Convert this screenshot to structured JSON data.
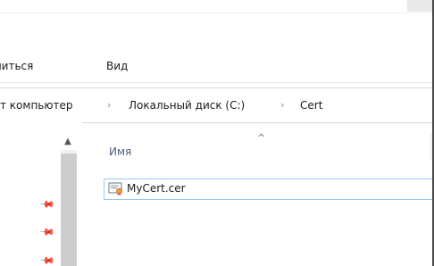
{
  "ribbon": {
    "tabs": [
      {
        "label": "литься"
      },
      {
        "label": "Вид"
      }
    ]
  },
  "address": {
    "crumbs": [
      {
        "label": "т компьютер"
      },
      {
        "label": "Локальный диск (C:)"
      },
      {
        "label": "Cert"
      }
    ],
    "separator": "›"
  },
  "nav": {
    "scroll_up_glyph": "▲",
    "pin_glyph": "📌"
  },
  "content": {
    "columns": [
      {
        "label": "Имя",
        "sorted": "ascending"
      }
    ],
    "sort_caret": "^",
    "files": [
      {
        "name": "MyCert.cer",
        "icon": "certificate-file-icon"
      }
    ]
  },
  "colors": {
    "selection_border": "#9ac7f2",
    "column_header_text": "#4d6082"
  }
}
